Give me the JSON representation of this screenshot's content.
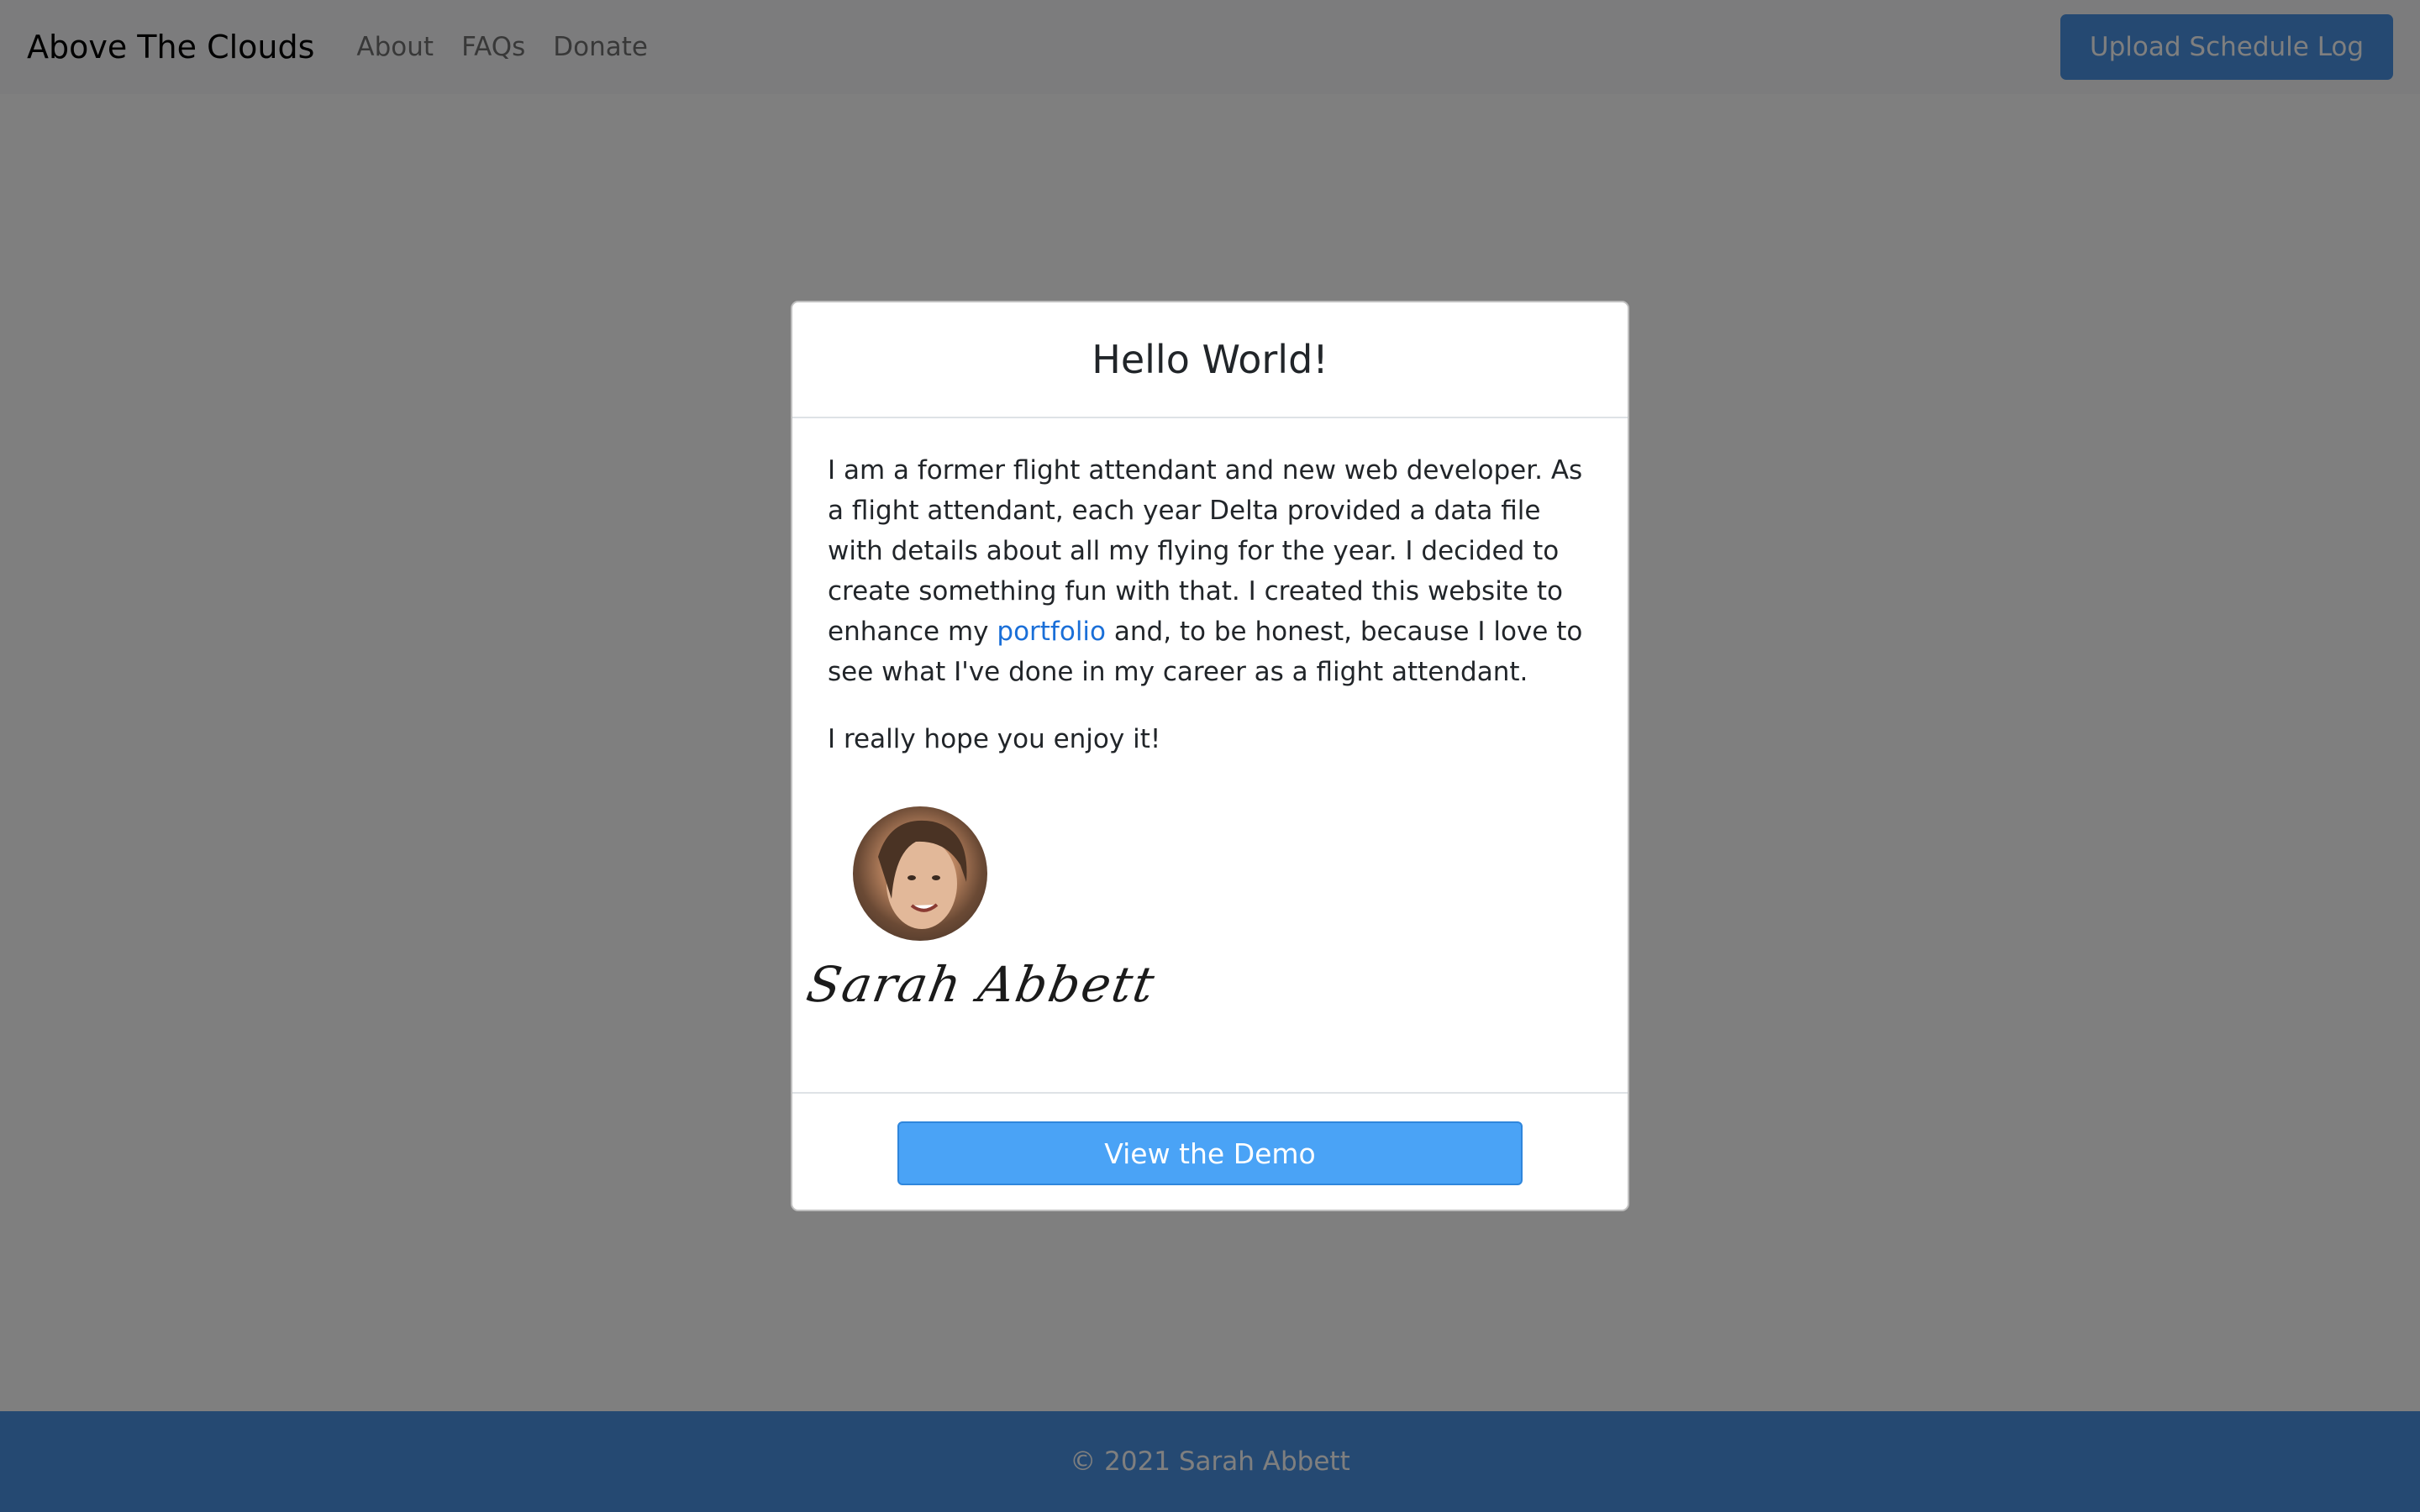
{
  "navbar": {
    "brand": "Above The Clouds",
    "links": [
      "About",
      "FAQs",
      "Donate"
    ],
    "upload_label": "Upload Schedule Log"
  },
  "modal": {
    "title": "Hello World!",
    "body_part1": "I am a former flight attendant and new web developer. As a flight attendant, each year Delta provided a data file with details about all my flying for the year. I decided to create something fun with that. I created this website to enhance my ",
    "link_text": "portfolio",
    "body_part2": " and, to be honest, because I love to see what I've done in my career as a flight attendant.",
    "closing": "I really hope you enjoy it!",
    "signature": "Sarah Abbett",
    "demo_button": "View the Demo"
  },
  "footer": {
    "text": "© 2021 Sarah Abbett"
  },
  "colors": {
    "primary": "#4a93e4",
    "demo_button": "#4aa3f6",
    "link": "#1a6fd8",
    "backdrop": "rgba(0,0,0,0.5)"
  }
}
